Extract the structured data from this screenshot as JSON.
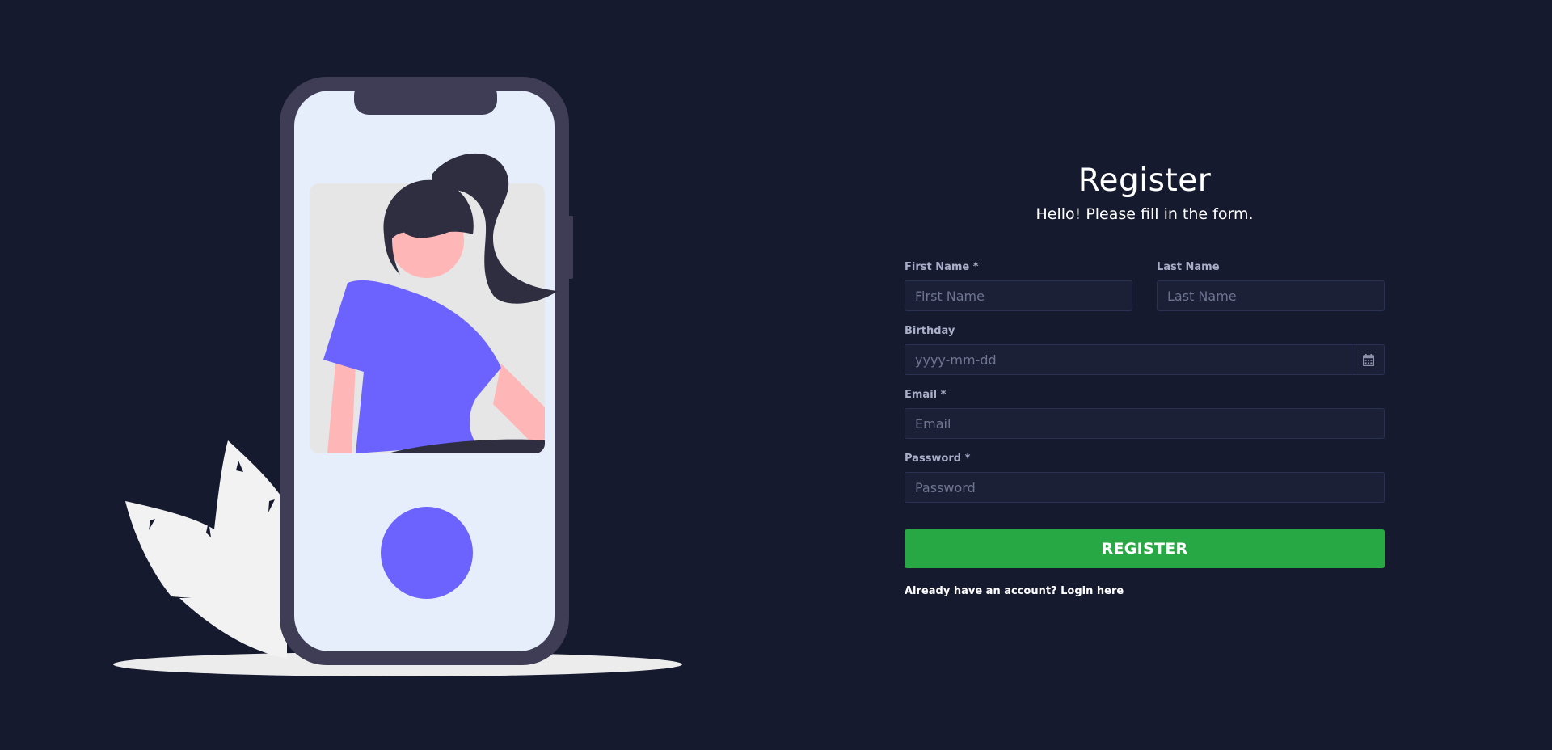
{
  "colors": {
    "background": "#161a2f",
    "input_background": "#1b2036",
    "input_border": "#2b3150",
    "label": "#a9afc8",
    "register_button": "#28a745",
    "accent_purple": "#6c63ff"
  },
  "illustration": {
    "name": "phone-illustration",
    "icons": [
      "phone-frame",
      "woman-figure",
      "leaf-plant",
      "ground-shadow"
    ]
  },
  "form": {
    "title": "Register",
    "subtitle": "Hello! Please fill in the form.",
    "first_name": {
      "label": "First Name *",
      "placeholder": "First Name"
    },
    "last_name": {
      "label": "Last Name",
      "placeholder": "Last Name"
    },
    "birthday": {
      "label": "Birthday",
      "placeholder": "yyyy-mm-dd",
      "icon": "calendar-icon"
    },
    "email": {
      "label": "Email *",
      "placeholder": "Email"
    },
    "password": {
      "label": "Password *",
      "placeholder": "Password"
    },
    "submit_label": "REGISTER",
    "login_prompt": "Already have an account?",
    "login_link": "Login here"
  }
}
